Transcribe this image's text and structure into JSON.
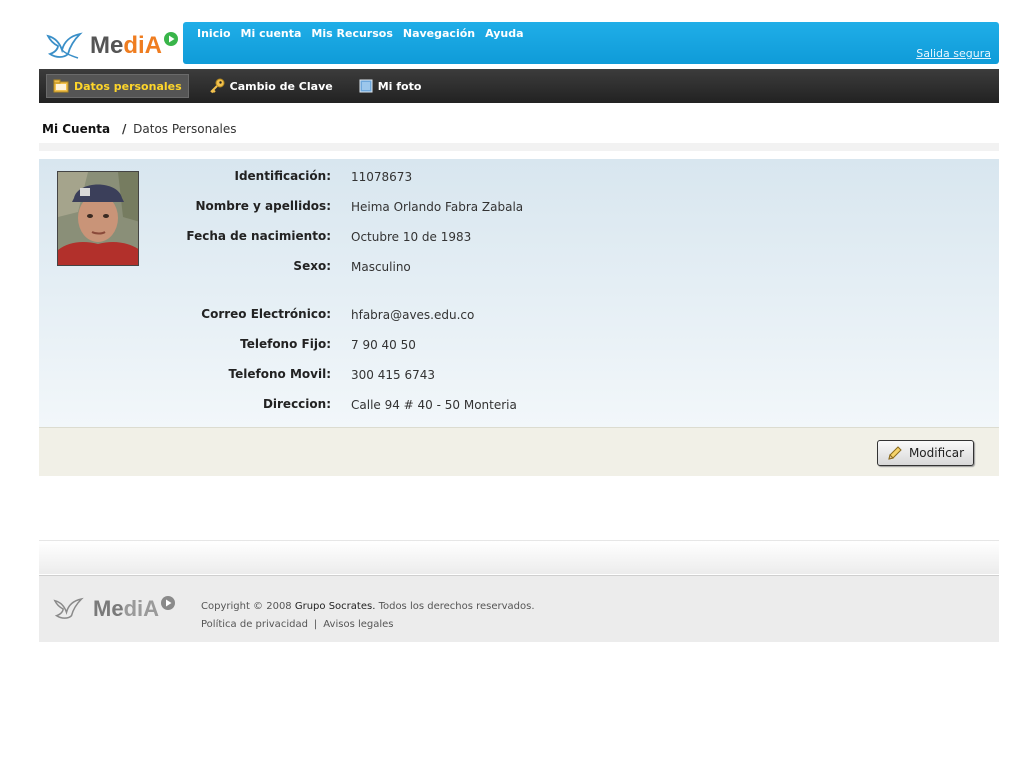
{
  "brand": {
    "name_prefix": "Me",
    "name_highlight": "diA",
    "colors": {
      "accent": "#ef7d20",
      "nav": "#1aa6e2"
    }
  },
  "topnav": {
    "items": [
      "Inicio",
      "Mi cuenta",
      "Mis Recursos",
      "Navegación",
      "Ayuda"
    ],
    "logout": "Salida segura"
  },
  "subnav": {
    "tabs": [
      {
        "label": "Datos personales",
        "icon": "folder-icon",
        "active": true
      },
      {
        "label": "Cambio de Clave",
        "icon": "key-icon",
        "active": false
      },
      {
        "label": "Mi foto",
        "icon": "picture-icon",
        "active": false
      }
    ]
  },
  "breadcrumb": {
    "root": "Mi Cuenta",
    "separator": "/",
    "current": "Datos Personales"
  },
  "profile": {
    "fields": [
      {
        "label": "Identificación:",
        "value": "11078673"
      },
      {
        "label": "Nombre y apellidos:",
        "value": "Heima Orlando Fabra Zabala"
      },
      {
        "label": "Fecha de nacimiento:",
        "value": "Octubre 10 de 1983"
      },
      {
        "label": "Sexo:",
        "value": "Masculino"
      },
      {
        "label": "Correo Electrónico:",
        "value": "hfabra@aves.edu.co"
      },
      {
        "label": "Telefono Fijo:",
        "value": "7 90 40 50"
      },
      {
        "label": "Telefono Movil:",
        "value": "300 415 6743"
      },
      {
        "label": "Direccion:",
        "value": "Calle 94 # 40 - 50 Monteria"
      }
    ]
  },
  "actions": {
    "modify_label": "Modificar"
  },
  "footer": {
    "copyright_prefix": "Copyright © 2008",
    "company": "Grupo Socrates.",
    "rights": "Todos los derechos reservados.",
    "links": [
      "Política de privacidad",
      "Avisos legales"
    ]
  }
}
